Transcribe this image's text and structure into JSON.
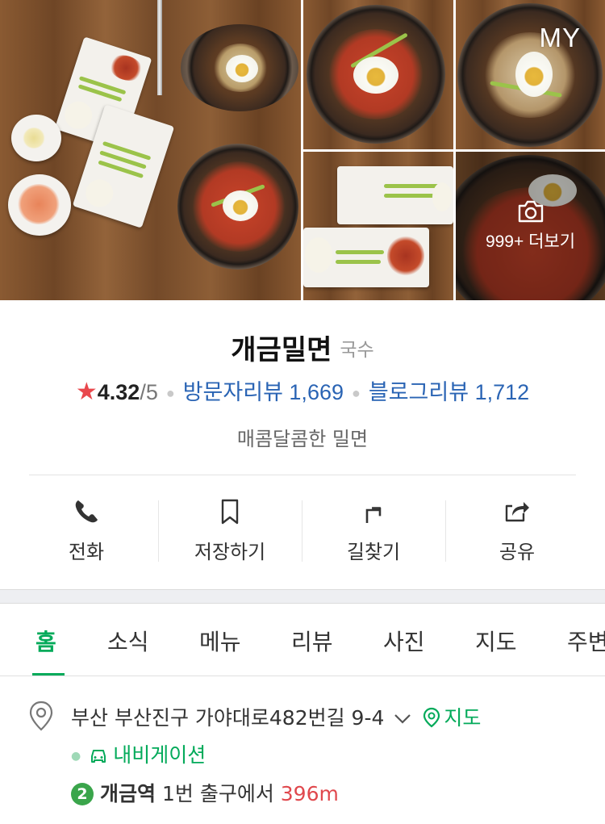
{
  "photos": {
    "my_badge": "MY",
    "more_label": "999+ 더보기",
    "colors": {
      "wood": "#7a4f2c",
      "noodle": "#c9442a"
    }
  },
  "place": {
    "name": "개금밀면",
    "category": "국수",
    "rating": "4.32",
    "rating_suffix": "/5",
    "visitor_review_label": "방문자리뷰 1,669",
    "blog_review_label": "블로그리뷰 1,712",
    "description": "매콤달콤한 밀면"
  },
  "actions": [
    {
      "label": "전화",
      "icon": "phone-icon"
    },
    {
      "label": "저장하기",
      "icon": "bookmark-icon"
    },
    {
      "label": "길찾기",
      "icon": "directions-icon"
    },
    {
      "label": "공유",
      "icon": "share-icon"
    }
  ],
  "tabs": [
    {
      "label": "홈",
      "active": true
    },
    {
      "label": "소식"
    },
    {
      "label": "메뉴"
    },
    {
      "label": "리뷰"
    },
    {
      "label": "사진"
    },
    {
      "label": "지도"
    },
    {
      "label": "주변"
    }
  ],
  "address": {
    "text": "부산 부산진구 가야대로482번길 9-4",
    "map_label": "지도",
    "navigation_label": "내비게이션",
    "subway_line": "2",
    "station": "개금역",
    "exit_text": "1번 출구에서",
    "distance": "396m"
  },
  "colors": {
    "accent_green": "#03aa5a",
    "link_blue": "#2a64b4",
    "star_red": "#e9484d",
    "distance_red": "#e0484d"
  }
}
